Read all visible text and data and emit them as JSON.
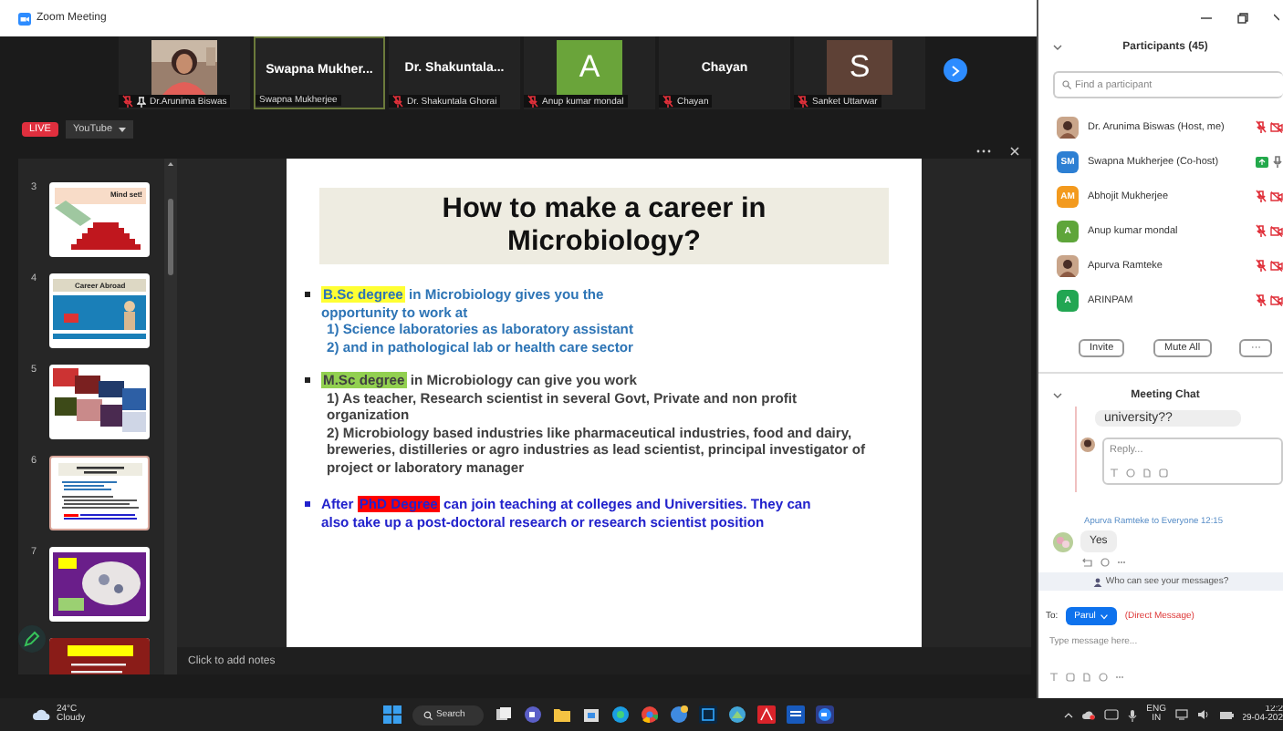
{
  "window": {
    "title": "Zoom Meeting"
  },
  "video_strip": {
    "tiles": [
      {
        "kind": "video",
        "label": "Dr.Arunima Biswas",
        "muted": true,
        "pinned": true,
        "selected": false
      },
      {
        "kind": "name",
        "display": "Swapna Mukher...",
        "label": "Swapna Mukherjee",
        "muted": false,
        "pinned": false,
        "selected": true
      },
      {
        "kind": "name",
        "display": "Dr. Shakuntala...",
        "label": "Dr. Shakuntala Ghorai",
        "muted": true,
        "pinned": false,
        "selected": false
      },
      {
        "kind": "avatar",
        "display": "A",
        "color": "#6aa43a",
        "label": "Anup kumar mondal",
        "muted": true,
        "pinned": false,
        "selected": false
      },
      {
        "kind": "name",
        "display": "Chayan",
        "label": "Chayan",
        "muted": true,
        "pinned": false,
        "selected": false
      },
      {
        "kind": "avatar",
        "display": "S",
        "color": "#5e4136",
        "label": "Sanket Uttarwar",
        "muted": true,
        "pinned": false,
        "selected": false
      }
    ]
  },
  "stream": {
    "badge": "LIVE",
    "service": "YouTube"
  },
  "slides_panel": {
    "thumbnails": [
      {
        "number": "3",
        "kind": "steps",
        "title": "Mind set!",
        "selected": false
      },
      {
        "number": "4",
        "kind": "banner",
        "title": "Career Abroad",
        "selected": false
      },
      {
        "number": "5",
        "kind": "collage",
        "selected": false
      },
      {
        "number": "6",
        "kind": "text",
        "selected": true
      },
      {
        "number": "7",
        "kind": "poster",
        "selected": false
      },
      {
        "kind": "dark",
        "selected": false
      }
    ]
  },
  "slide": {
    "title": "How to make a career in Microbiology?",
    "bullets": [
      {
        "highlight": {
          "text": "B.Sc degree",
          "color": "#ffff33"
        },
        "text": "in Microbiology gives you the opportunity to work at",
        "color": "#2e75b6",
        "lines": [
          "1) Science laboratories as laboratory assistant",
          "2)  and in pathological lab or health care sector"
        ]
      },
      {
        "highlight": {
          "text": "M.Sc degree",
          "color": "#92d050"
        },
        "text": "in Microbiology can give you work",
        "color": "#404040",
        "lines": [
          "1) As teacher, Research scientist in several Govt, Private and non profit organization",
          "2) Microbiology based industries like pharmaceutical industries, food and dairy, breweries, distilleries or agro industries as lead scientist, principal investigator of project or laboratory manager"
        ]
      },
      {
        "lead": "After",
        "highlight": {
          "text": "PhD Degree",
          "color": "#ff0000"
        },
        "text": "can join teaching at colleges and Universities. They can also take up a post-doctoral research or research scientist position",
        "color": "#2222cc"
      }
    ]
  },
  "notes": {
    "placeholder": "Click to add notes"
  },
  "participants": {
    "title": "Participants (45)",
    "search_placeholder": "Find a participant",
    "list": [
      {
        "name": "Dr. Arunima Biswas (Host, me)",
        "muted": true,
        "video_off": true,
        "sharing": false
      },
      {
        "name": "Swapna Mukherjee (Co-host)",
        "kind": "initials",
        "initials": "SM",
        "color": "#2d7fd3",
        "muted": false,
        "video_off": false,
        "sharing": true
      },
      {
        "name": "Abhojit Mukherjee",
        "kind": "initials",
        "initials": "AM",
        "color": "#f39a1e",
        "muted": true,
        "video_off": true,
        "sharing": false
      },
      {
        "name": "Anup kumar mondal",
        "kind": "initials",
        "initials": "A",
        "color": "#5ea53a",
        "muted": true,
        "video_off": true,
        "sharing": false
      },
      {
        "name": "Apurva Ramteke",
        "muted": true,
        "video_off": true,
        "sharing": false
      },
      {
        "name": "ARINPAM",
        "kind": "initials",
        "initials": "A",
        "color": "#22a652",
        "muted": true,
        "video_off": true,
        "sharing": false
      }
    ],
    "buttons": [
      "Invite",
      "Mute All",
      "···"
    ]
  },
  "chat": {
    "title": "Meeting Chat",
    "quoted": "university??",
    "reply_placeholder": "Reply...",
    "message": {
      "header": "Apurva Ramteke to Everyone 12:15",
      "text": "Yes"
    },
    "privacy": "Who can see your messages?",
    "to_label": "To:",
    "recipient": "Parul",
    "recipient_note": "(Direct Message)",
    "placeholder": "Type message here..."
  },
  "taskbar": {
    "temperature": "24°C",
    "weather": "Cloudy",
    "search": "Search",
    "language": "ENG",
    "region": "IN",
    "time": "12:2",
    "date": "29-04-202"
  }
}
